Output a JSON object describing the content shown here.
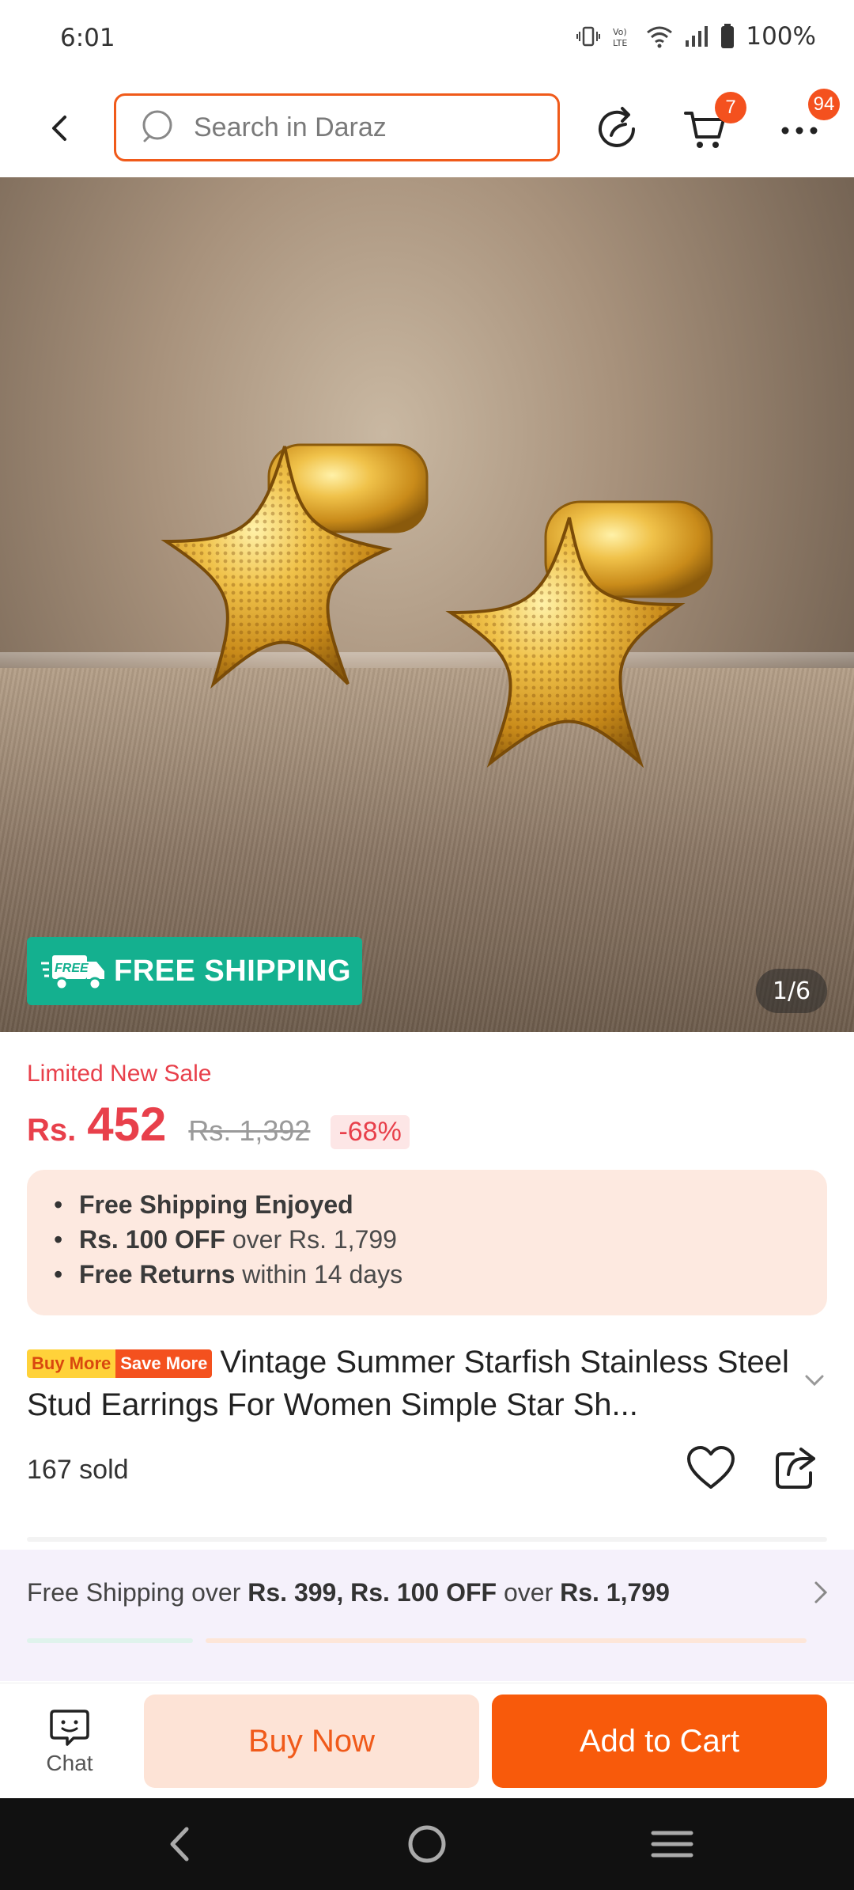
{
  "status_bar": {
    "time": "6:01",
    "battery": "100%",
    "icons": [
      "vibrate-icon",
      "volte-icon",
      "wifi-icon",
      "signal-icon",
      "battery-icon"
    ]
  },
  "top_nav": {
    "search_placeholder": "Search in Daraz",
    "cart_badge": "7",
    "more_badge": "94",
    "icons": [
      "back-icon",
      "search-icon",
      "share-refresh-icon",
      "cart-icon",
      "more-icon"
    ]
  },
  "gallery": {
    "free_shipping": "FREE SHIPPING",
    "free_truck_text": "FREE",
    "counter": "1/6"
  },
  "pricing": {
    "sale_label": "Limited New Sale",
    "currency": "Rs.",
    "price": "452",
    "old_price": "Rs. 1,392",
    "discount": "-68%"
  },
  "benefits": [
    {
      "bold": "Free Shipping Enjoyed",
      "rest": ""
    },
    {
      "bold": "Rs. 100 OFF",
      "rest": " over Rs. 1,799"
    },
    {
      "bold": "Free Returns",
      "rest": " within 14 days"
    }
  ],
  "product": {
    "badge_left": "Buy More",
    "badge_right": "Save More",
    "title": "Vintage Summer Starfish Stainless Steel Stud Earrings For Women Simple Star Sh...",
    "sold": "167 sold"
  },
  "shipping_promo": {
    "prefix": "Free Shipping over ",
    "bold1": "Rs. 399, Rs. 100 OFF",
    "middle": " over ",
    "bold2": "Rs. 1,799"
  },
  "actions": {
    "chat": "Chat",
    "buy_now": "Buy Now",
    "add_to_cart": "Add to Cart"
  },
  "colors": {
    "accent": "#f85a0b",
    "price_red": "#e8404b",
    "free_shipping_green": "#14b08f"
  }
}
